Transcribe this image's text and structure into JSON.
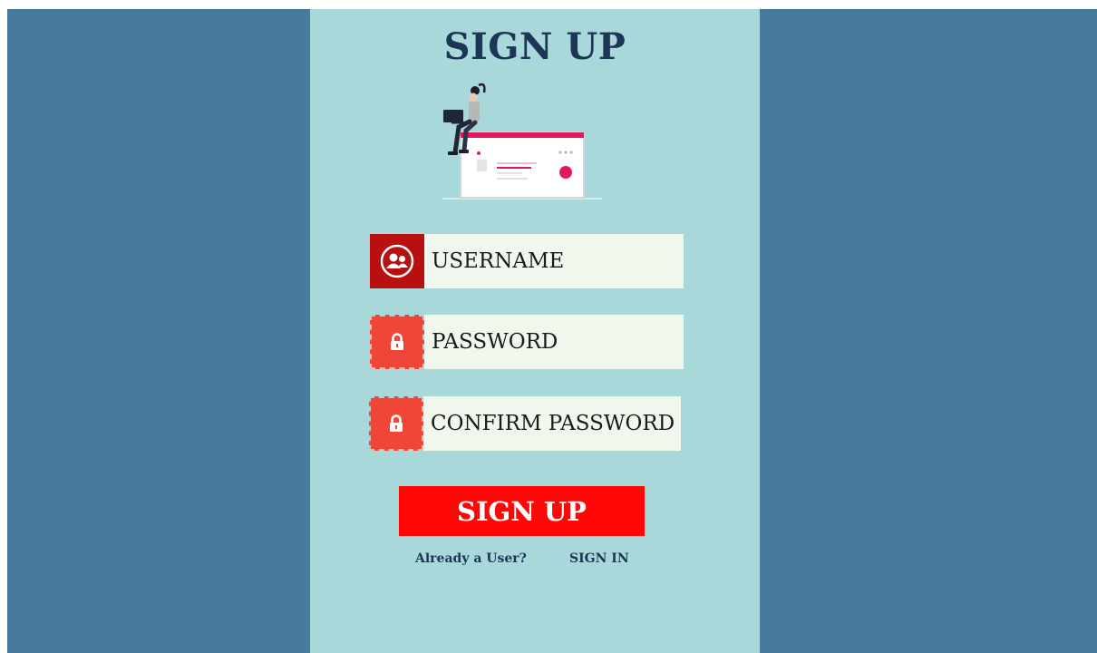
{
  "page": {
    "title": "SIGN UP"
  },
  "form": {
    "username_label": "USERNAME",
    "password_label": "PASSWORD",
    "confirm_label": "CONFIRM PASSWORD",
    "submit_label": "SIGN UP"
  },
  "footer": {
    "prompt": "Already a User?",
    "signin_label": "SIGN IN"
  },
  "icons": {
    "username": "users-icon",
    "password": "lock-icon",
    "confirm": "lock-icon"
  },
  "colors": {
    "outer_background": "#467b9c",
    "panel_background": "#a9d8da",
    "title": "#1d3557",
    "field_background": "#f0f8ee",
    "user_icon_box": "#b80f0f",
    "lock_icon_box": "#ef4639",
    "button": "#ff0707",
    "illustration_accent": "#e0195a"
  }
}
